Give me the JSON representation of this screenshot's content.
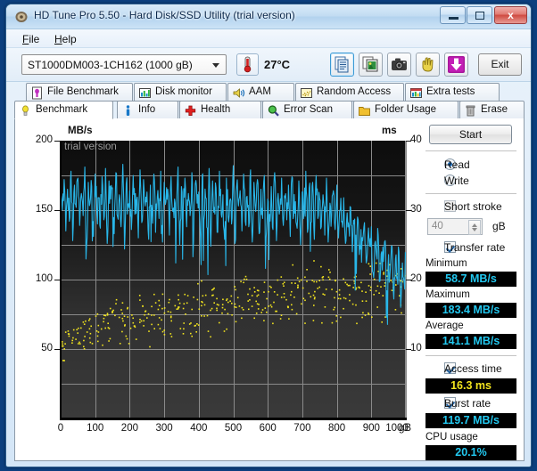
{
  "window": {
    "title": "HD Tune Pro 5.50 - Hard Disk/SSD Utility (trial version)",
    "icon": "hdtune-app-icon",
    "minimize_label": "",
    "maximize_label": "",
    "close_label": "x"
  },
  "menu": {
    "items": [
      {
        "label": "File",
        "mnemonic": "F"
      },
      {
        "label": "Help",
        "mnemonic": "H"
      }
    ]
  },
  "toolbar": {
    "drive": {
      "selected": "ST1000DM003-1CH162 (1000 gB)",
      "options": [
        "ST1000DM003-1CH162 (1000 gB)"
      ]
    },
    "temperature": "27°C",
    "temperature_icon": "thermometer-icon",
    "buttons": [
      {
        "name": "copy-icon",
        "label": ""
      },
      {
        "name": "copy-image-icon",
        "label": ""
      },
      {
        "name": "camera-icon",
        "label": ""
      },
      {
        "name": "hand-icon",
        "label": ""
      },
      {
        "name": "download-arrow-icon",
        "label": ""
      }
    ],
    "exit_label": "Exit"
  },
  "tabs": {
    "top_row": [
      {
        "label": "File Benchmark",
        "icon": "file-benchmark-icon",
        "active": false
      },
      {
        "label": "Disk monitor",
        "icon": "bar-chart-icon",
        "active": false
      },
      {
        "label": "AAM",
        "icon": "speaker-icon",
        "active": false
      },
      {
        "label": "Random Access",
        "icon": "scatter-icon",
        "active": false
      },
      {
        "label": "Extra tests",
        "icon": "extra-tests-icon",
        "active": false
      }
    ],
    "bottom_row": [
      {
        "label": "Benchmark",
        "icon": "bulb-icon",
        "active": true
      },
      {
        "label": "Info",
        "icon": "info-icon",
        "active": false
      },
      {
        "label": "Health",
        "icon": "health-cross-icon",
        "active": false
      },
      {
        "label": "Error Scan",
        "icon": "magnifier-icon",
        "active": false
      },
      {
        "label": "Folder Usage",
        "icon": "folder-icon",
        "active": false
      },
      {
        "label": "Erase",
        "icon": "trash-icon",
        "active": false
      }
    ]
  },
  "sidebar": {
    "start_label": "Start",
    "mode": {
      "read_label": "Read",
      "write_label": "Write",
      "selected": "Read"
    },
    "short_stroke": {
      "label": "Short stroke",
      "checked": false,
      "value": "40",
      "unit": "gB"
    },
    "transfer_rate": {
      "label": "Transfer rate",
      "checked": true,
      "minimum_label": "Minimum",
      "minimum_value": "58.7 MB/s",
      "maximum_label": "Maximum",
      "maximum_value": "183.4 MB/s",
      "average_label": "Average",
      "average_value": "141.1 MB/s"
    },
    "access_time": {
      "label": "Access time",
      "checked": true,
      "value": "16.3 ms"
    },
    "burst_rate": {
      "label": "Burst rate",
      "checked": true,
      "value": "119.7 MB/s"
    },
    "cpu_usage": {
      "label": "CPU usage",
      "value": "20.1%"
    },
    "colors": {
      "value_cyan": "#22c8f0",
      "value_yellow": "#f2e41e",
      "value_bg": "#000000"
    }
  },
  "chart_data": {
    "type": "line",
    "title": "",
    "watermark": "trial version",
    "xlabel": "gB",
    "xlabel_unit": "gB",
    "ylabel": "MB/s",
    "ylabel_right": "ms",
    "xlim": [
      0,
      1000
    ],
    "ylim": [
      0,
      200
    ],
    "ylim_right": [
      0,
      40
    ],
    "xticks": [
      0,
      100,
      200,
      300,
      400,
      500,
      600,
      700,
      800,
      900,
      1000
    ],
    "yticks_left": [
      50,
      100,
      150,
      200
    ],
    "yticks_right": [
      10,
      20,
      30,
      40
    ],
    "grid": true,
    "legend": "none",
    "plot_bg": "#1a1a1a",
    "series": [
      {
        "name": "Transfer rate",
        "type": "line",
        "color": "#29b6e8",
        "axis": "left",
        "unit": "MB/s",
        "x": [
          0,
          5,
          10,
          15,
          20,
          25,
          30,
          35,
          40,
          45,
          50,
          55,
          60,
          65,
          70,
          75,
          80,
          85,
          90,
          95,
          100,
          105,
          110,
          115,
          120,
          125,
          130,
          135,
          140,
          145,
          150,
          155,
          160,
          165,
          170,
          175,
          180,
          185,
          190,
          195,
          200,
          205,
          210,
          215,
          220,
          225,
          230,
          235,
          240,
          245,
          250,
          255,
          260,
          265,
          270,
          275,
          280,
          285,
          290,
          295,
          300,
          305,
          310,
          315,
          320,
          325,
          330,
          335,
          340,
          345,
          350,
          355,
          360,
          365,
          370,
          375,
          380,
          385,
          390,
          395,
          400,
          405,
          410,
          415,
          420,
          425,
          430,
          435,
          440,
          445,
          450,
          455,
          460,
          465,
          470,
          475,
          480,
          485,
          490,
          495,
          500,
          505,
          510,
          515,
          520,
          525,
          530,
          535,
          540,
          545,
          550,
          555,
          560,
          565,
          570,
          575,
          580,
          585,
          590,
          595,
          600,
          605,
          610,
          615,
          620,
          625,
          630,
          635,
          640,
          645,
          650,
          655,
          660,
          665,
          670,
          675,
          680,
          685,
          690,
          695,
          700,
          705,
          710,
          715,
          720,
          725,
          730,
          735,
          740,
          745,
          750,
          755,
          760,
          765,
          770,
          775,
          780,
          785,
          790,
          795,
          800,
          805,
          810,
          815,
          820,
          825,
          830,
          835,
          840,
          845,
          850,
          855,
          860,
          865,
          870,
          875,
          880,
          885,
          890,
          895,
          900,
          905,
          910,
          915,
          920,
          925,
          930,
          935,
          940,
          945,
          950,
          955,
          960,
          965,
          970,
          975,
          980,
          985,
          990,
          995,
          1000
        ],
        "y": [
          160,
          150,
          172,
          135,
          165,
          142,
          178,
          128,
          168,
          152,
          173,
          139,
          162,
          146,
          181,
          124,
          170,
          155,
          167,
          131,
          176,
          148,
          159,
          137,
          174,
          143,
          180,
          126,
          171,
          158,
          166,
          133,
          177,
          145,
          161,
          138,
          183,
          122,
          169,
          154,
          164,
          136,
          175,
          147,
          157,
          130,
          179,
          141,
          172,
          153,
          163,
          129,
          168,
          150,
          176,
          134,
          160,
          144,
          178,
          127,
          170,
          156,
          165,
          132,
          174,
          149,
          158,
          140,
          181,
          125,
          167,
          151,
          173,
          138,
          162,
          146,
          177,
          128,
          169,
          155,
          163,
          131,
          175,
          143,
          159,
          137,
          180,
          124,
          171,
          152,
          166,
          134,
          178,
          147,
          161,
          129,
          173,
          145,
          157,
          140,
          182,
          126,
          168,
          153,
          164,
          135,
          176,
          142,
          160,
          138,
          179,
          127,
          170,
          149,
          172,
          133,
          165,
          144,
          175,
          130,
          158,
          147,
          167,
          136,
          177,
          128,
          162,
          151,
          173,
          139,
          159,
          143,
          168,
          131,
          174,
          146,
          156,
          137,
          171,
          125,
          163,
          148,
          178,
          134,
          166,
          141,
          170,
          129,
          175,
          144,
          158,
          138,
          161,
          132,
          173,
          127,
          155,
          146,
          164,
          136,
          168,
          130,
          150,
          142,
          159,
          126,
          148,
          138,
          152,
          120,
          140,
          132,
          145,
          118,
          136,
          128,
          141,
          112,
          130,
          124,
          138,
          105,
          126,
          118,
          132,
          99,
          120,
          113,
          128,
          92,
          118,
          108,
          124,
          86,
          115,
          102,
          120,
          80,
          112,
          98,
          116,
          76,
          110,
          94,
          112
        ]
      },
      {
        "name": "Access time",
        "type": "scatter",
        "color": "#f2e41e",
        "axis": "right",
        "unit": "ms",
        "x_range": [
          0,
          1000
        ],
        "y_range": [
          8,
          26
        ],
        "description": "Scatter cloud rising from ~9 ms at 0 gB to ~22 ms near 1000 gB",
        "average": 16.3,
        "n_points": 430
      }
    ]
  }
}
